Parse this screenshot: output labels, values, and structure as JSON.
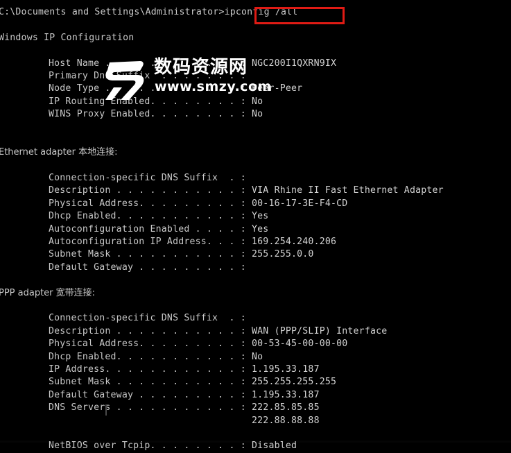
{
  "console": {
    "background_color": "#000000",
    "text_color": "#c9c9c9",
    "highlight_color": "#e01b14",
    "prompt": {
      "path": "C:\\Documents and Settings\\Administrator>",
      "command": "ipconfig /all"
    },
    "sections": [
      {
        "heading": "Windows IP Configuration",
        "rows": [
          {
            "label": "Host Name . . . . . . . . . . . . :",
            "value": "NGC200I1QXRN9IX"
          },
          {
            "label": "Primary Dns Suffix  . . . . . . . :",
            "value": ""
          },
          {
            "label": "Node Type . . . . . . . . . . . . :",
            "value": "Peer-Peer"
          },
          {
            "label": "IP Routing Enabled. . . . . . . . :",
            "value": "No"
          },
          {
            "label": "WINS Proxy Enabled. . . . . . . . :",
            "value": "No"
          }
        ]
      },
      {
        "heading": "Ethernet adapter 本地连接:",
        "rows": [
          {
            "label": "Connection-specific DNS Suffix  . :",
            "value": ""
          },
          {
            "label": "Description . . . . . . . . . . . :",
            "value": "VIA Rhine II Fast Ethernet Adapter"
          },
          {
            "label": "Physical Address. . . . . . . . . :",
            "value": "00-16-17-3E-F4-CD"
          },
          {
            "label": "Dhcp Enabled. . . . . . . . . . . :",
            "value": "Yes"
          },
          {
            "label": "Autoconfiguration Enabled . . . . :",
            "value": "Yes"
          },
          {
            "label": "Autoconfiguration IP Address. . . :",
            "value": "169.254.240.206"
          },
          {
            "label": "Subnet Mask . . . . . . . . . . . :",
            "value": "255.255.0.0"
          },
          {
            "label": "Default Gateway . . . . . . . . . :",
            "value": ""
          }
        ]
      },
      {
        "heading": "PPP adapter 宽带连接:",
        "rows": [
          {
            "label": "Connection-specific DNS Suffix  . :",
            "value": ""
          },
          {
            "label": "Description . . . . . . . . . . . :",
            "value": "WAN (PPP/SLIP) Interface"
          },
          {
            "label": "Physical Address. . . . . . . . . :",
            "value": "00-53-45-00-00-00"
          },
          {
            "label": "Dhcp Enabled. . . . . . . . . . . :",
            "value": "No"
          },
          {
            "label": "IP Address. . . . . . . . . . . . :",
            "value": "1.195.33.187"
          },
          {
            "label": "Subnet Mask . . . . . . . . . . . :",
            "value": "255.255.255.255"
          },
          {
            "label": "Default Gateway . . . . . . . . . :",
            "value": "1.195.33.187"
          },
          {
            "label": "DNS Servers . . . . . . . . . . . :",
            "value": "222.85.85.85"
          },
          {
            "label": "                                   ",
            "value": "222.88.88.88"
          },
          {
            "label": "NetBIOS over Tcpip. . . . . . . . :",
            "value": "Disabled"
          }
        ]
      }
    ]
  },
  "watermark": {
    "logo": "smzy-logo-icon",
    "chinese_text": "数码资源网",
    "url_text": "www.smzy.com"
  }
}
